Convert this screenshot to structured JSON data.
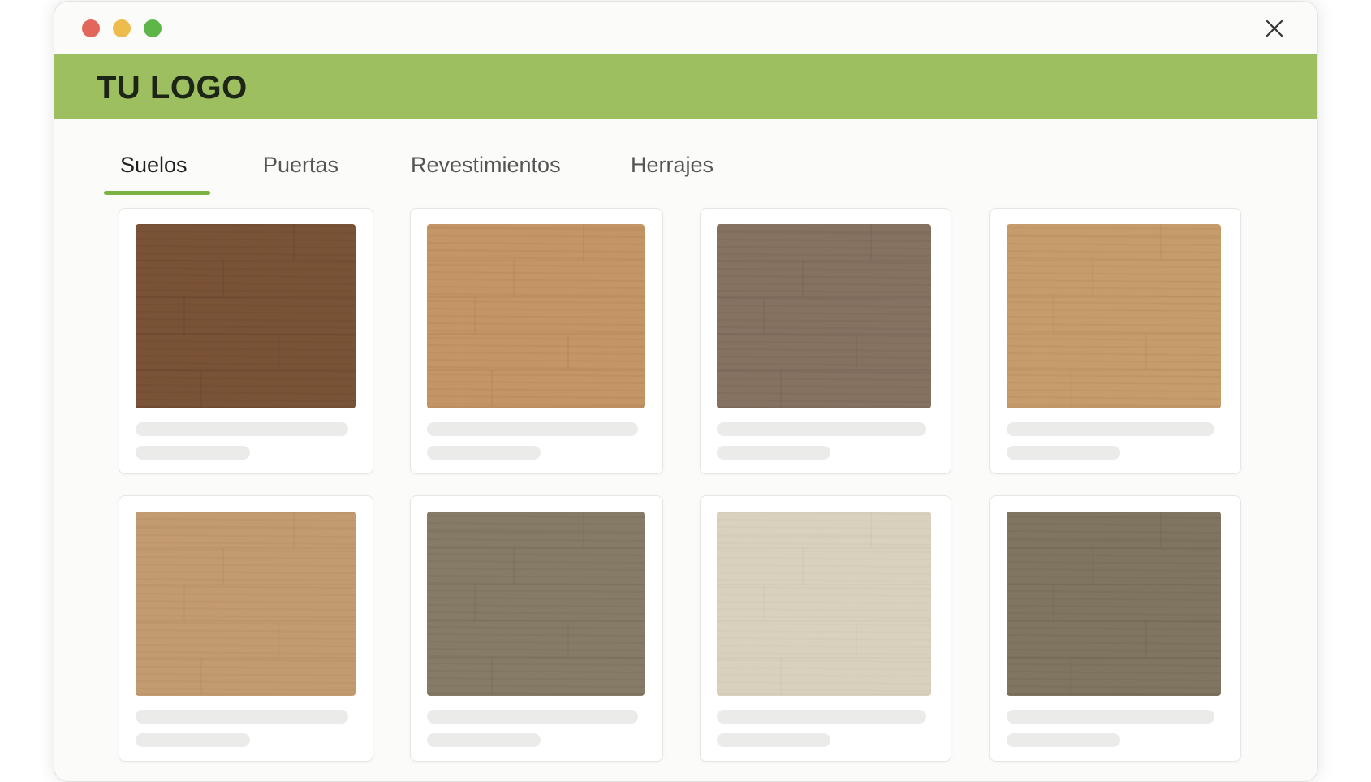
{
  "window": {
    "controls": {
      "close_color": "#e0675a",
      "minimize_color": "#ecbd4d",
      "maximize_color": "#5db645"
    }
  },
  "header": {
    "logo_text": "TU LOGO",
    "background": "#9dbf5f"
  },
  "tabs": [
    {
      "label": "Suelos",
      "active": true
    },
    {
      "label": "Puertas",
      "active": false
    },
    {
      "label": "Revestimientos",
      "active": false
    },
    {
      "label": "Herrajes",
      "active": false
    }
  ],
  "accent_color": "#7bb342",
  "products": [
    {
      "swatch_color": "#7a5336",
      "grain_color": "#5e3e28",
      "state": "loading"
    },
    {
      "swatch_color": "#c49565",
      "grain_color": "#a57a4f",
      "state": "loading"
    },
    {
      "swatch_color": "#857260",
      "grain_color": "#6b5b4d",
      "state": "loading"
    },
    {
      "swatch_color": "#c69c6b",
      "grain_color": "#a98055",
      "state": "loading"
    },
    {
      "swatch_color": "#c39b70",
      "grain_color": "#a8825a",
      "state": "loading"
    },
    {
      "swatch_color": "#857b66",
      "grain_color": "#6d6452",
      "state": "loading"
    },
    {
      "swatch_color": "#d9d1bd",
      "grain_color": "#c4baa3",
      "state": "loading"
    },
    {
      "swatch_color": "#7f7560",
      "grain_color": "#675e4c",
      "state": "loading"
    }
  ]
}
